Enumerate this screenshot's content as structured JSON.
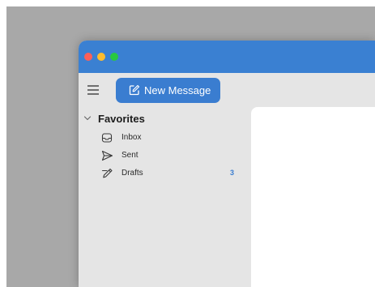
{
  "sidebar": {
    "new_message_label": "New Message",
    "favorites_title": "Favorites",
    "items": [
      {
        "label": "Inbox",
        "count": ""
      },
      {
        "label": "Sent",
        "count": ""
      },
      {
        "label": "Drafts",
        "count": "3"
      }
    ]
  },
  "colors": {
    "titlebar": "#3a80d2",
    "accent": "#3a7dd0",
    "badge": "#3a7dd0",
    "sidebar_bg": "#e5e5e5"
  },
  "icons": {
    "menu": "hamburger-icon",
    "compose": "compose-icon",
    "favorites_toggle": "chevron-down-icon",
    "inbox": "inbox-tray-icon",
    "sent": "paper-plane-icon",
    "drafts": "pencil-icon"
  }
}
